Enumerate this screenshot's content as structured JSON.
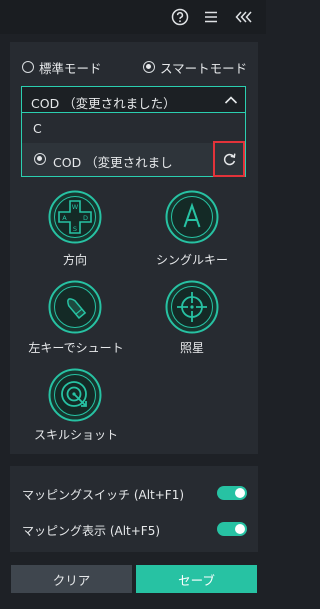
{
  "header": {
    "icons": [
      "help-icon",
      "menu-icon",
      "collapse-icon"
    ]
  },
  "mode": {
    "standard_label": "標準モード",
    "smart_label": "スマートモード",
    "selected": "smart"
  },
  "config_select": {
    "current": "COD （変更されました）",
    "options": [
      {
        "label": "C"
      },
      {
        "label": "COD （変更されまし"
      }
    ]
  },
  "skills": [
    {
      "label": "方向",
      "icon": "dpad-icon"
    },
    {
      "label": "シングルキー",
      "icon": "single-key-icon"
    },
    {
      "label": "左キーでシュート",
      "icon": "bullet-icon"
    },
    {
      "label": "照星",
      "icon": "crosshair-icon"
    },
    {
      "label": "スキルショット",
      "icon": "skill-shot-icon"
    }
  ],
  "toggles": [
    {
      "label": "マッピングスイッチ (Alt+F1)",
      "on": true
    },
    {
      "label": "マッピング表示 (Alt+F5)",
      "on": true
    }
  ],
  "footer": {
    "clear_label": "クリア",
    "save_label": "セーブ"
  },
  "colors": {
    "accent": "#27c2a3",
    "highlight_border": "#e2333a",
    "background": "#1e2126",
    "panel": "#272b31"
  }
}
